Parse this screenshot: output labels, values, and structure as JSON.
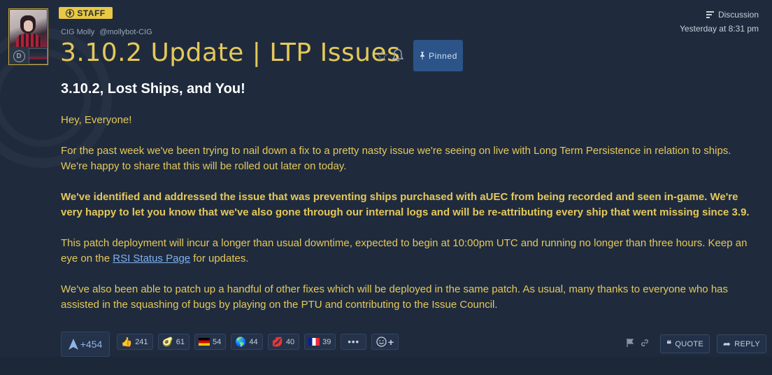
{
  "author": {
    "role_badge": "STAFF",
    "name": "CIG Molly",
    "handle": "@mollybot-CIG",
    "org_badge": "D"
  },
  "post": {
    "category": "Discussion",
    "timestamp": "Yesterday at 8:31 pm",
    "title": "3.10.2 Update | LTP Issues",
    "pinned_label": "Pinned",
    "heading": "3.10.2, Lost Ships, and You!",
    "greeting": "Hey, Everyone!",
    "para1": "For the past week we've been trying to nail down a fix to a pretty nasty issue we're seeing on live with Long Term Persistence in relation to ships. We're happy to share that this will be rolled out later on today.",
    "para2": "We've identified and addressed the issue that was preventing ships purchased with aUEC from being recorded and seen in-game. We're very happy to let you know that we've also gone through our internal logs and will be re-attributing every ship that went missing since 3.9.",
    "para3_before": "This patch deployment will incur a longer than usual downtime, expected to begin at 10:00pm UTC and running no longer than three hours. Keep an eye on the ",
    "para3_link": "RSI Status Page",
    "para3_after": " for updates.",
    "para4": "We've also been able to patch up a handful of other fixes which will be deployed in the same patch. As usual, many thanks to everyone who has assisted in the squashing of bugs by playing on the PTU and contributing to the Issue Council."
  },
  "votes": {
    "count": "+454"
  },
  "reactions": [
    {
      "icon": "thumbs-up",
      "glyph": "👍",
      "count": "241"
    },
    {
      "icon": "avocado",
      "glyph": "🥑",
      "count": "61"
    },
    {
      "icon": "germany-flag",
      "glyph": "",
      "count": "54"
    },
    {
      "icon": "earth-globe",
      "glyph": "🌎",
      "count": "44"
    },
    {
      "icon": "lips",
      "glyph": "💋",
      "count": "40"
    },
    {
      "icon": "france-flag",
      "glyph": "",
      "count": "39"
    }
  ],
  "more_label": "•••",
  "actions": {
    "quote": "QUOTE",
    "reply": "REPLY"
  },
  "colors": {
    "background": "#1f2b3d",
    "accent": "#e5c85a",
    "pinned": "#2c5488",
    "link": "#7fb1ef"
  }
}
